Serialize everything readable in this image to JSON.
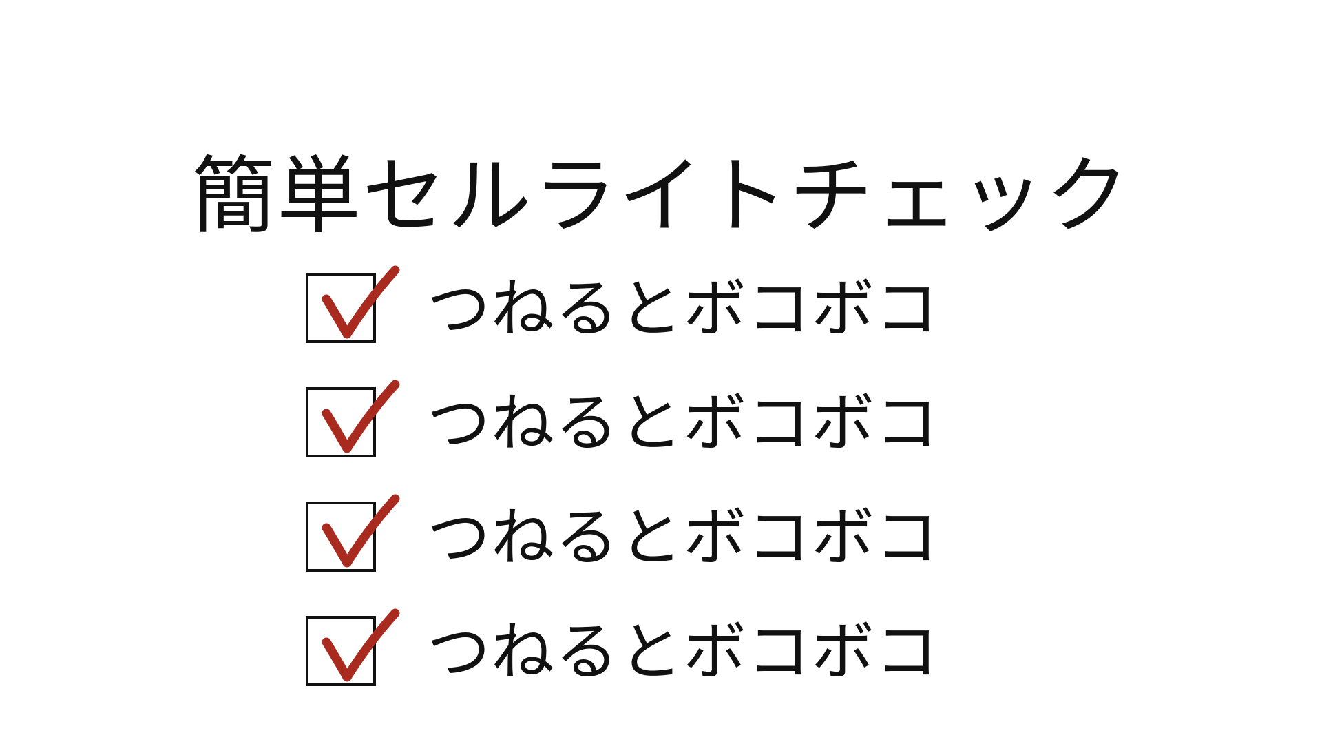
{
  "page": {
    "title": "簡単セルライトチェック"
  },
  "checklist": {
    "items": [
      {
        "label": "つねるとボコボコ",
        "checked": true
      },
      {
        "label": "つねるとボコボコ",
        "checked": true
      },
      {
        "label": "つねるとボコボコ",
        "checked": true
      },
      {
        "label": "つねるとボコボコ",
        "checked": true
      }
    ]
  },
  "colors": {
    "text": "#111111",
    "check_mark": "#a92b1f",
    "background": "#ffffff"
  },
  "icons": {
    "check": "checkmark-icon"
  }
}
